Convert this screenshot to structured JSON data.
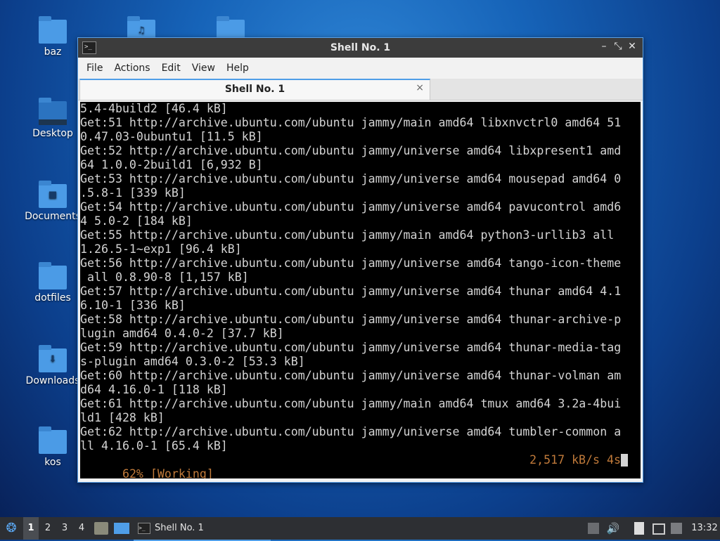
{
  "desktop": {
    "icons": [
      {
        "label": "baz"
      },
      {
        "label": "Desktop"
      },
      {
        "label": "Documents"
      },
      {
        "label": "dotfiles"
      },
      {
        "label": "Downloads"
      },
      {
        "label": "kos"
      }
    ]
  },
  "window": {
    "title": "Shell No. 1",
    "menu": [
      "File",
      "Actions",
      "Edit",
      "View",
      "Help"
    ],
    "tab": {
      "label": "Shell No. 1",
      "close": "×"
    },
    "controls": {
      "minimize": "–",
      "maximize": "⤡",
      "close": "✕"
    }
  },
  "terminal": {
    "lines": [
      "5.4-4build2 [46.4 kB]",
      "Get:51 http://archive.ubuntu.com/ubuntu jammy/main amd64 libxnvctrl0 amd64 51",
      "0.47.03-0ubuntu1 [11.5 kB]",
      "Get:52 http://archive.ubuntu.com/ubuntu jammy/universe amd64 libxpresent1 amd",
      "64 1.0.0-2build1 [6,932 B]",
      "Get:53 http://archive.ubuntu.com/ubuntu jammy/universe amd64 mousepad amd64 0",
      ".5.8-1 [339 kB]",
      "Get:54 http://archive.ubuntu.com/ubuntu jammy/universe amd64 pavucontrol amd6",
      "4 5.0-2 [184 kB]",
      "Get:55 http://archive.ubuntu.com/ubuntu jammy/main amd64 python3-urllib3 all",
      "1.26.5-1~exp1 [96.4 kB]",
      "Get:56 http://archive.ubuntu.com/ubuntu jammy/universe amd64 tango-icon-theme",
      " all 0.8.90-8 [1,157 kB]",
      "Get:57 http://archive.ubuntu.com/ubuntu jammy/universe amd64 thunar amd64 4.1",
      "6.10-1 [336 kB]",
      "Get:58 http://archive.ubuntu.com/ubuntu jammy/universe amd64 thunar-archive-p",
      "lugin amd64 0.4.0-2 [37.7 kB]",
      "Get:59 http://archive.ubuntu.com/ubuntu jammy/universe amd64 thunar-media-tag",
      "s-plugin amd64 0.3.0-2 [53.3 kB]",
      "Get:60 http://archive.ubuntu.com/ubuntu jammy/universe amd64 thunar-volman am",
      "d64 4.16.0-1 [118 kB]",
      "Get:61 http://archive.ubuntu.com/ubuntu jammy/main amd64 tmux amd64 3.2a-4bui",
      "ld1 [428 kB]",
      "Get:62 http://archive.ubuntu.com/ubuntu jammy/universe amd64 tumbler-common a",
      "ll 4.16.0-1 [65.4 kB]"
    ],
    "status": {
      "progress": "62% [Working]",
      "speed": "2,517 kB/s 4s"
    }
  },
  "taskbar": {
    "workspaces": [
      "1",
      "2",
      "3",
      "4"
    ],
    "active_workspace": "1",
    "task": {
      "label": "Shell No. 1"
    },
    "clock": "13:32"
  },
  "colors": {
    "accent": "#4f9ee8",
    "status_text": "#c07a3a"
  }
}
